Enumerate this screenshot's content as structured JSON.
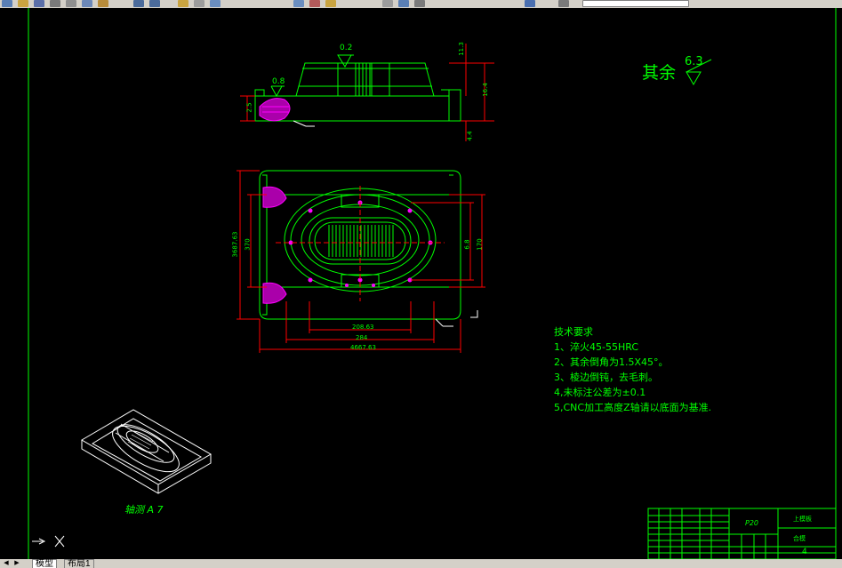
{
  "drawing": {
    "roughness_rest_label": "其余",
    "roughness_rest_value": "6.3",
    "roughness_top_1": "0.2",
    "roughness_top_2": "0.8",
    "tech_notes": [
      "技术要求",
      "1、淬火45-55HRC",
      "2、其余倒角为1.5X45°。",
      "3、棱边倒钝，去毛刺。",
      "4,未标注公差为±0.1",
      "5,CNC加工高度Z轴请以底面为基准."
    ],
    "iso_view_label": "轴测 A 7",
    "dims": {
      "top_width": "208.63",
      "mid_width": "284",
      "overall_width": "4667.63",
      "left_height_outer": "3687.63",
      "left_height_inner": "370",
      "right_height_inner": "6.8",
      "right_height_outer": "170",
      "side_1": "11.3",
      "side_2": "2.5",
      "side_3": "4.4",
      "side_4": "16.4"
    },
    "title_block": {
      "scale": "P20",
      "title": "上模板",
      "material": "合模",
      "sheet": "4"
    }
  },
  "tabs": [
    {
      "label": "模型"
    },
    {
      "label": "布局1"
    }
  ],
  "colors": {
    "canvas": "#000000",
    "geometry": "#00ff00",
    "dimension": "#ff0000",
    "hatch": "#ff00ff",
    "cyan_center": "#00ffff",
    "white_lines": "#ffffff"
  }
}
